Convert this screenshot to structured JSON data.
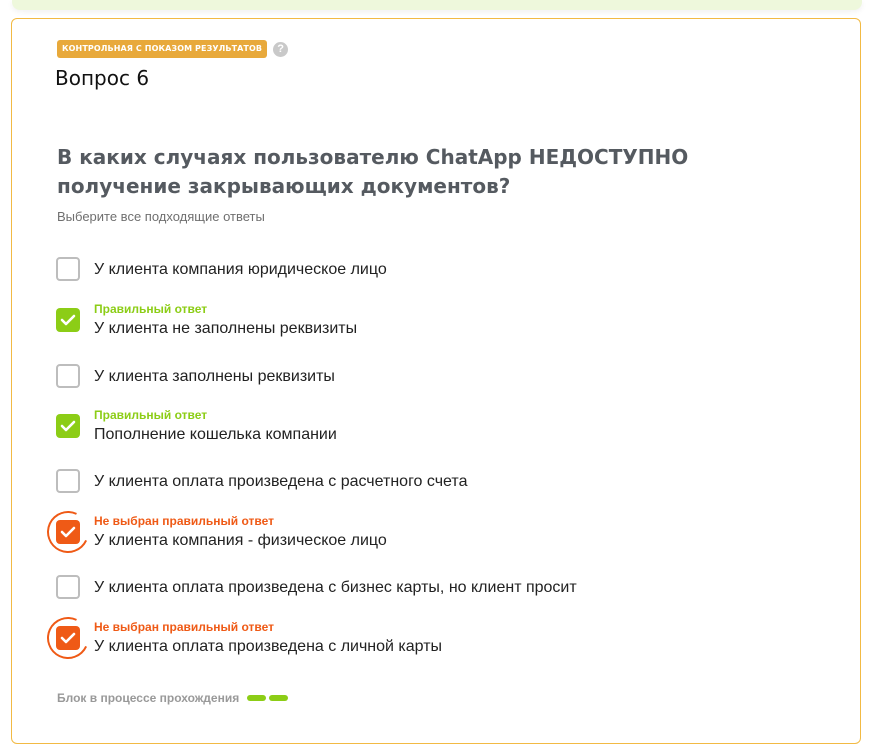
{
  "header": {
    "tag": "КОНТРОЛЬНАЯ С ПОКАЗОМ РЕЗУЛЬТАТОВ",
    "help": "?",
    "question_number": "Вопрос 6"
  },
  "question": {
    "text": "В каких случаях пользователю ChatApp НЕДОСТУПНО получение закрывающих документов?",
    "hint": "Выберите все подходящие ответы"
  },
  "options": [
    {
      "text": "У клиента компания юридическое лицо",
      "state": "unchecked",
      "status": ""
    },
    {
      "text": "У клиента не заполнены реквизиты",
      "state": "correct",
      "status": "Правильный ответ"
    },
    {
      "text": "У клиента заполнены реквизиты",
      "state": "unchecked",
      "status": ""
    },
    {
      "text": "Пополнение кошелька компании",
      "state": "correct",
      "status": "Правильный ответ"
    },
    {
      "text": "У клиента оплата произведена с расчетного счета",
      "state": "unchecked",
      "status": ""
    },
    {
      "text": "У клиента компания - физическое лицо",
      "state": "missed",
      "status": "Не выбран правильный ответ"
    },
    {
      "text": "У клиента оплата произведена с бизнес карты, но клиент просит",
      "state": "unchecked",
      "status": ""
    },
    {
      "text": "У клиента оплата произведена с личной карты",
      "state": "missed",
      "status": "Не выбран правильный ответ"
    }
  ],
  "footer": {
    "text": "Блок в процессе прохождения",
    "progress_completed": 2,
    "progress_total": 2
  },
  "colors": {
    "correct": "#8ccd16",
    "missed": "#ef5a16",
    "tag": "#e8a93b",
    "card_border": "#f2ba44"
  }
}
